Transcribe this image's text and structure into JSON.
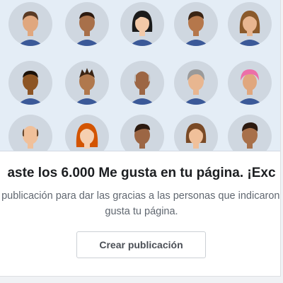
{
  "headline": "aste los 6.000 Me gusta en tu página. ¡Exc",
  "subtext": "ea una publicación para dar las gracias a las personas que indicaron que les gusta tu página.",
  "create_button_label": "Crear publicación",
  "colors": {
    "banner_bg": "#e4edf6",
    "avatar_circle": "#cfd7e0",
    "headline_text": "#1c1e21",
    "subtext": "#606770",
    "button_text": "#4b4f56",
    "button_border": "#ccd0d5"
  }
}
